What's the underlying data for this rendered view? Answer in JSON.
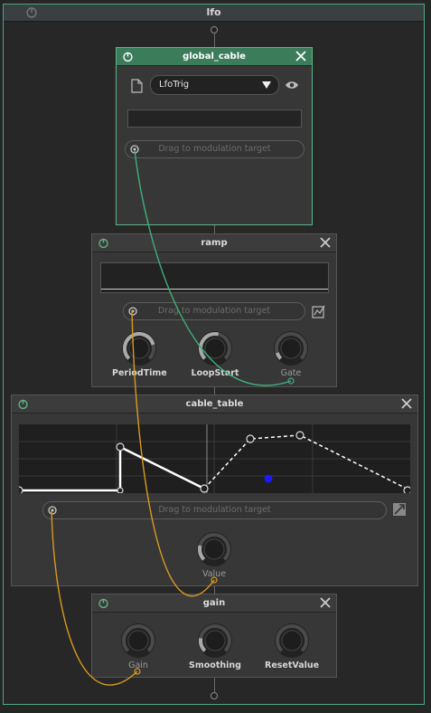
{
  "container": {
    "title": "lfo"
  },
  "nodes": {
    "global_cable": {
      "title": "global_cable",
      "dropdown_value": "LfoTrig",
      "drag_label": "Drag to modulation target"
    },
    "ramp": {
      "title": "ramp",
      "drag_label": "Drag to modulation target",
      "knobs": [
        {
          "label": "PeriodTime",
          "value": 0.78
        },
        {
          "label": "LoopStart",
          "value": 0.55
        },
        {
          "label": "Gate",
          "value": 0.1
        }
      ]
    },
    "cable_table": {
      "title": "cable_table",
      "drag_label": "Drag to modulation target",
      "knob": {
        "label": "Value",
        "value": 0.22
      }
    },
    "gain": {
      "title": "gain",
      "knobs": [
        {
          "label": "Gain",
          "value": 0.0
        },
        {
          "label": "Smoothing",
          "value": 0.2
        },
        {
          "label": "ResetValue",
          "value": 0.0
        }
      ]
    }
  },
  "colors": {
    "selected_border": "#5db58a",
    "selected_header": "#3b7c5a",
    "cable_green": "#3fae7c",
    "cable_orange": "#d89a1f",
    "table_cursor": "#1a1aff"
  }
}
